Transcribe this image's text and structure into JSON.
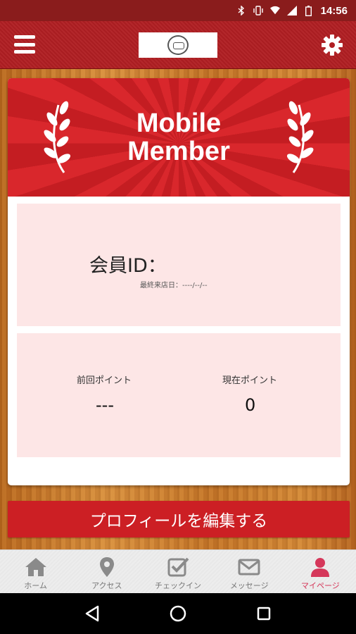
{
  "status_bar": {
    "time": "14:56"
  },
  "header": {
    "menu_icon": "menu-icon",
    "settings_icon": "gear-icon"
  },
  "banner": {
    "title_line1": "Mobile",
    "title_line2": "Member"
  },
  "member": {
    "id_label": "会員ID：",
    "last_visit": "最終来店日：----/--/--"
  },
  "points": {
    "previous_label": "前回ポイント",
    "previous_value": "---",
    "current_label": "現在ポイント",
    "current_value": "0"
  },
  "profile_button": "プロフィールを編集する",
  "tabs": [
    {
      "label": "ホーム",
      "icon": "home-icon",
      "active": false
    },
    {
      "label": "アクセス",
      "icon": "map-pin-icon",
      "active": false
    },
    {
      "label": "チェックイン",
      "icon": "checkbox-icon",
      "active": false
    },
    {
      "label": "メッセージ",
      "icon": "mail-icon",
      "active": false
    },
    {
      "label": "マイページ",
      "icon": "person-icon",
      "active": true
    }
  ],
  "colors": {
    "brand_red": "#cc1f24",
    "active_tab": "#d5375a",
    "panel_pink": "#fde6e6"
  }
}
